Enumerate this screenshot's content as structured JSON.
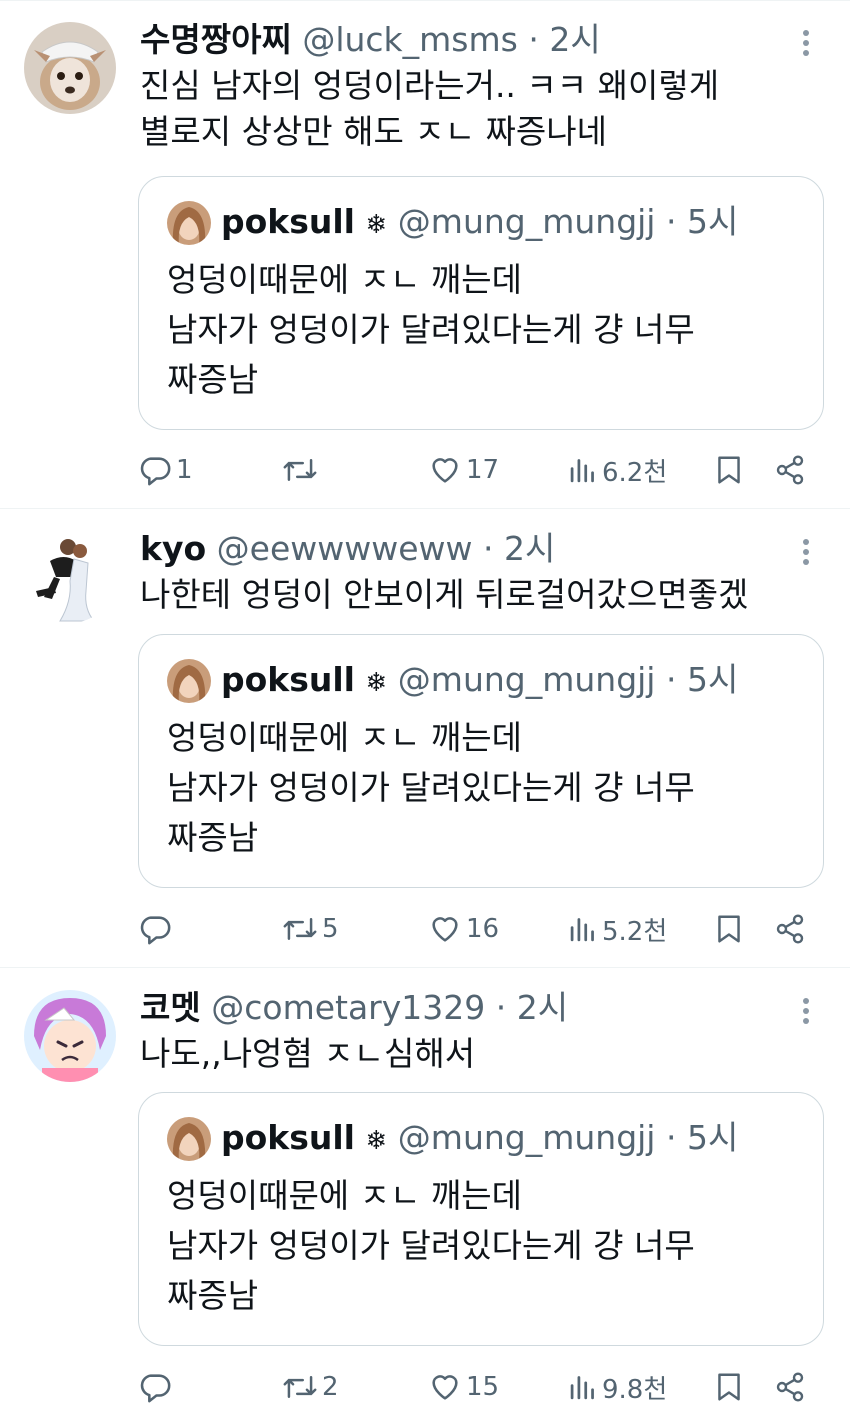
{
  "tweets": [
    {
      "name": "수명짱아찌",
      "handle": "@luck_msms",
      "dot": "·",
      "time": "2시",
      "text": "진심 남자의 엉덩이라는거.. ㅋㅋ 왜이렇게\n별로지 상상만 해도 ㅈㄴ 짜증나네",
      "quote": {
        "name": "poksull",
        "badge": "❄",
        "handle": "@mung_mungjj",
        "dot": "·",
        "time": "5시",
        "text": "엉덩이때문에 ㅈㄴ 깨는데\n남자가 엉덩이가 달려있다는게 걍 너무\n짜증남"
      },
      "stats": {
        "replies": "1",
        "retweets": "",
        "likes": "17",
        "views": "6.2천"
      }
    },
    {
      "name": "kyo",
      "handle": "@eewwwweww",
      "dot": "·",
      "time": "2시",
      "text": "나한테 엉덩이 안보이게 뒤로걸어갔으면좋겠",
      "quote": {
        "name": "poksull",
        "badge": "❄",
        "handle": "@mung_mungjj",
        "dot": "·",
        "time": "5시",
        "text": "엉덩이때문에 ㅈㄴ 깨는데\n남자가 엉덩이가 달려있다는게 걍 너무\n짜증남"
      },
      "stats": {
        "replies": "",
        "retweets": "5",
        "likes": "16",
        "views": "5.2천"
      }
    },
    {
      "name": "코멧",
      "handle": "@cometary1329",
      "dot": "·",
      "time": "2시",
      "text": "나도,,나엉혐 ㅈㄴ심해서",
      "quote": {
        "name": "poksull",
        "badge": "❄",
        "handle": "@mung_mungjj",
        "dot": "·",
        "time": "5시",
        "text": "엉덩이때문에 ㅈㄴ 깨는데\n남자가 엉덩이가 달려있다는게 걍 너무\n짜증남"
      },
      "stats": {
        "replies": "",
        "retweets": "2",
        "likes": "15",
        "views": "9.8천"
      }
    }
  ],
  "icons": {
    "reply": "reply-icon",
    "retweet": "retweet-icon",
    "like": "heart-icon",
    "views": "views-icon",
    "bookmark": "bookmark-icon",
    "share": "share-icon",
    "more": "more-icon"
  },
  "colors": {
    "text": "#0f1419",
    "secondary": "#536471",
    "border": "#cfd9de"
  }
}
